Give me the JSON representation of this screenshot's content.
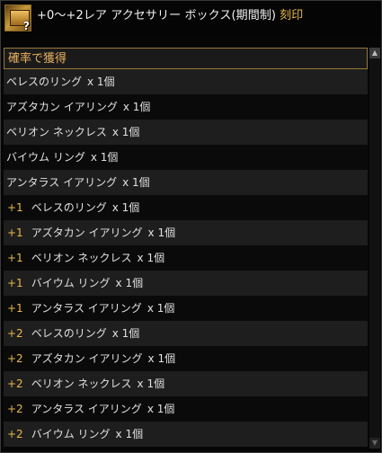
{
  "header": {
    "title": "+0～+2レア アクセサリー ボックス(期間制)",
    "tag": "刻印",
    "icon": "gold-box-question-icon"
  },
  "section": {
    "label": "確率で獲得"
  },
  "rows": [
    {
      "level": "",
      "name": "ベレスのリング",
      "qty": "x 1個"
    },
    {
      "level": "",
      "name": "アズタカン イアリング",
      "qty": "x 1個"
    },
    {
      "level": "",
      "name": "ベリオン ネックレス",
      "qty": "x 1個"
    },
    {
      "level": "",
      "name": "バイウム リング",
      "qty": "x 1個"
    },
    {
      "level": "",
      "name": "アンタラス イアリング",
      "qty": "x 1個"
    },
    {
      "level": "+1",
      "name": "ベレスのリング",
      "qty": "x 1個"
    },
    {
      "level": "+1",
      "name": "アズタカン イアリング",
      "qty": "x 1個"
    },
    {
      "level": "+1",
      "name": "ベリオン ネックレス",
      "qty": "x 1個"
    },
    {
      "level": "+1",
      "name": "バイウム リング",
      "qty": "x 1個"
    },
    {
      "level": "+1",
      "name": "アンタラス イアリング",
      "qty": "x 1個"
    },
    {
      "level": "+2",
      "name": "ベレスのリング",
      "qty": "x 1個"
    },
    {
      "level": "+2",
      "name": "アズタカン イアリング",
      "qty": "x 1個"
    },
    {
      "level": "+2",
      "name": "ベリオン ネックレス",
      "qty": "x 1個"
    },
    {
      "level": "+2",
      "name": "アンタラス イアリング",
      "qty": "x 1個"
    },
    {
      "level": "+2",
      "name": "バイウム リング",
      "qty": "x 1個"
    }
  ],
  "scrollbar": {
    "up": "▲",
    "down": "▼"
  },
  "colors": {
    "accent": "#e8b848",
    "section_border": "#9a7a3a"
  }
}
